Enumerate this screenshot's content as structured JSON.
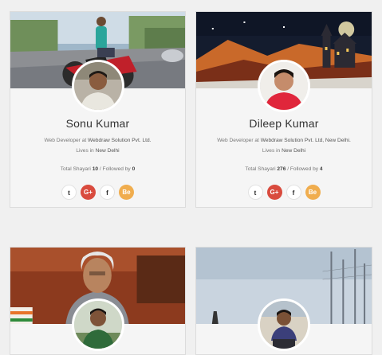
{
  "profiles": [
    {
      "name": "Sonu Kumar",
      "role_prefix": "Web Developer at ",
      "company": "Webdraw Solution Pvt. Ltd.",
      "lives_prefix": "Lives in ",
      "city": "New Delhi",
      "total_label": "Total Shayari ",
      "total": "10",
      "followed_label": " / Followed by ",
      "followers": "0",
      "cover_scene": "street-motorbike",
      "avatar_icon": "man-photo-icon"
    },
    {
      "name": "Dileep Kumar",
      "role_prefix": "Web Developer at ",
      "company": "Webdraw Solution Pvt. Ltd, New Delhi.",
      "lives_prefix": "Lives in ",
      "city": "New Delhi",
      "total_label": "Total Shayari ",
      "total": "276",
      "followed_label": " / Followed by ",
      "followers": "4",
      "cover_scene": "night-castle",
      "avatar_icon": "man-red-shirt-photo-icon"
    },
    {
      "cover_scene": "portrait-elder",
      "avatar_icon": "man-outdoor-photo-icon"
    },
    {
      "cover_scene": "pale-sky-poles",
      "avatar_icon": "man-sitting-photo-icon"
    }
  ],
  "social": {
    "twitter": "t",
    "googleplus": "G+",
    "facebook": "f",
    "behance": "Be"
  },
  "colors": {
    "googleplus": "#d94b3e",
    "behance": "#f0ad4e",
    "card_bg": "#f5f5f5"
  }
}
